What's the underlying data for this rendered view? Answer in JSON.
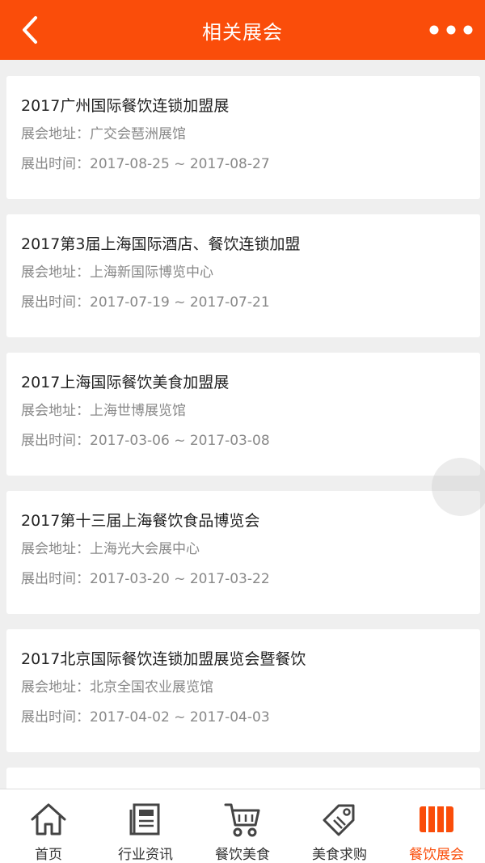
{
  "header": {
    "title": "相关展会",
    "accent": "#fa4d0a"
  },
  "exhibitions": [
    {
      "name": "2017广州国际餐饮连锁加盟展",
      "address": "展会地址：广交会琶洲展馆",
      "time": "展出时间：2017-08-25 ~ 2017-08-27"
    },
    {
      "name": "2017第3届上海国际酒店、餐饮连锁加盟",
      "address": "展会地址：上海新国际博览中心",
      "time": "展出时间：2017-07-19 ~ 2017-07-21"
    },
    {
      "name": "2017上海国际餐饮美食加盟展",
      "address": "展会地址：上海世博展览馆",
      "time": "展出时间：2017-03-06 ~ 2017-03-08"
    },
    {
      "name": "2017第十三届上海餐饮食品博览会",
      "address": "展会地址：上海光大会展中心",
      "time": "展出时间：2017-03-20 ~ 2017-03-22"
    },
    {
      "name": "2017北京国际餐饮连锁加盟展览会暨餐饮",
      "address": "展会地址：北京全国农业展览馆",
      "time": "展出时间：2017-04-02 ~ 2017-04-03"
    }
  ],
  "tabbar": {
    "items": [
      {
        "label": "首页",
        "icon": "home-icon",
        "active": false
      },
      {
        "label": "行业资讯",
        "icon": "news-icon",
        "active": false
      },
      {
        "label": "餐饮美食",
        "icon": "cart-icon",
        "active": false
      },
      {
        "label": "美食求购",
        "icon": "tag-icon",
        "active": false
      },
      {
        "label": "餐饮展会",
        "icon": "exhibition-icon",
        "active": true
      }
    ]
  }
}
